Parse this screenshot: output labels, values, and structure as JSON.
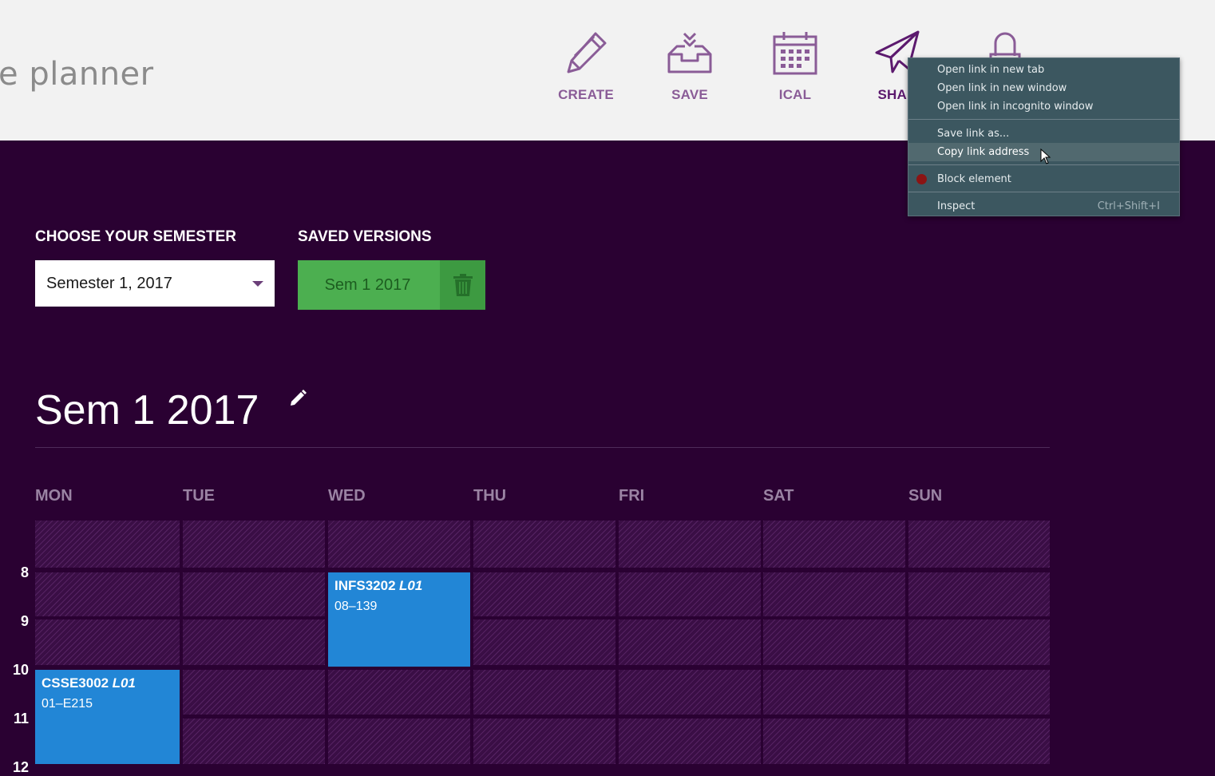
{
  "header": {
    "brand": "e planner",
    "nav": [
      {
        "label": "CREATE",
        "icon": "pencil-icon"
      },
      {
        "label": "SAVE",
        "icon": "inbox-download-icon"
      },
      {
        "label": "ICAL",
        "icon": "calendar-icon"
      },
      {
        "label": "SHAR",
        "icon": "paper-plane-icon"
      },
      {
        "label": "",
        "icon": "lock-icon"
      }
    ]
  },
  "controls": {
    "semester_label": "CHOOSE YOUR SEMESTER",
    "semester_value": "Semester 1, 2017",
    "saved_label": "SAVED VERSIONS",
    "saved_versions": [
      "Sem 1 2017"
    ]
  },
  "plan": {
    "title": "Sem 1 2017"
  },
  "timetable": {
    "days": [
      "MON",
      "TUE",
      "WED",
      "THU",
      "FRI",
      "SAT",
      "SUN"
    ],
    "hours": [
      "8",
      "9",
      "10",
      "11",
      "12"
    ],
    "classes": [
      {
        "code": "INFS3202",
        "section": "L01",
        "room": "08–139",
        "day": "WED",
        "start": 8,
        "end": 10
      },
      {
        "code": "CSSE3002",
        "section": "L01",
        "room": "01–E215",
        "day": "MON",
        "start": 10,
        "end": 12
      }
    ]
  },
  "context_menu": {
    "items": [
      {
        "label": "Open link in new tab"
      },
      {
        "label": "Open link in new window"
      },
      {
        "label": "Open link in incognito window"
      },
      {
        "label": "Save link as..."
      },
      {
        "label": "Copy link address",
        "highlighted": true
      },
      {
        "label": "Block element",
        "icon": "ublock-icon"
      },
      {
        "label": "Inspect",
        "shortcut": "Ctrl+Shift+I"
      }
    ]
  },
  "colors": {
    "page_background": "#2a0132",
    "header_background": "#f2f2f2",
    "nav_accent": "#8a5c97",
    "saved_version_green": "#4caf50",
    "class_block_blue": "#2286d6",
    "menu_background": "#3c5760"
  }
}
